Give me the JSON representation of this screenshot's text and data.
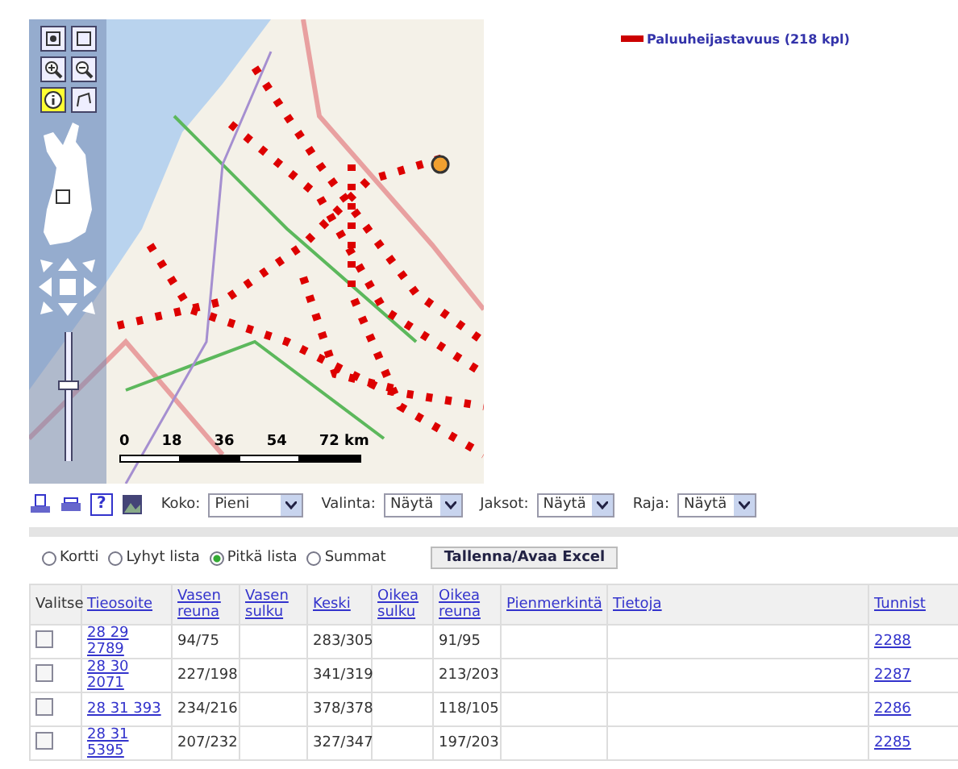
{
  "map": {
    "tools": [
      {
        "kind": "extent",
        "selected": false
      },
      {
        "kind": "box",
        "selected": false
      },
      {
        "kind": "zoomin",
        "selected": false
      },
      {
        "kind": "zoomout",
        "selected": false
      },
      {
        "kind": "info",
        "selected": true
      },
      {
        "kind": "measure",
        "selected": false
      }
    ],
    "zoom_level": {
      "level": 0.6
    },
    "scale": [
      "0",
      "18",
      "36",
      "54",
      "72 km"
    ],
    "legend": {
      "label": "Paluuheijastavuus (218 kpl)",
      "color": "#cc0000"
    }
  },
  "toolbar": {
    "help": "?",
    "selects": [
      {
        "label": "Koko:",
        "value": "Pieni"
      },
      {
        "label": "Valinta:",
        "value": "Näytä"
      },
      {
        "label": "Jaksot:",
        "value": "Näytä"
      },
      {
        "label": "Raja:",
        "value": "Näytä"
      }
    ]
  },
  "views": [
    {
      "label": "Kortti",
      "selected": false
    },
    {
      "label": "Lyhyt lista",
      "selected": false
    },
    {
      "label": "Pitkä lista",
      "selected": true
    },
    {
      "label": "Summat",
      "selected": false
    }
  ],
  "excel_button": "Tallenna/Avaa Excel",
  "table": {
    "columns": [
      {
        "label": "Valitse"
      },
      {
        "label": "Tieosoite"
      },
      {
        "label": "Vasen reuna"
      },
      {
        "label": "Vasen sulku"
      },
      {
        "label": "Keski"
      },
      {
        "label": "Oikea sulku"
      },
      {
        "label": "Oikea reuna"
      },
      {
        "label": "Pienmerkintä"
      },
      {
        "label": "Tietoja"
      },
      {
        "label": "Tunnist"
      }
    ],
    "rows": [
      {
        "checked": false,
        "tieosoite": "28 29 2789",
        "vasen_reuna": "94/75",
        "keski": "283/305",
        "oikea_reuna": "91/95",
        "tunniste": "2288"
      },
      {
        "checked": false,
        "tieosoite": "28 30 2071",
        "vasen_reuna": "227/198",
        "keski": "341/319",
        "oikea_reuna": "213/203",
        "tunniste": "2287"
      },
      {
        "checked": false,
        "tieosoite": "28 31 393",
        "vasen_reuna": "234/216",
        "keski": "378/378",
        "oikea_reuna": "118/105",
        "tunniste": "2286"
      },
      {
        "checked": false,
        "tieosoite": "28 31 5395",
        "vasen_reuna": "207/232",
        "keski": "327/347",
        "oikea_reuna": "197/203",
        "tunniste": "2285"
      }
    ]
  }
}
